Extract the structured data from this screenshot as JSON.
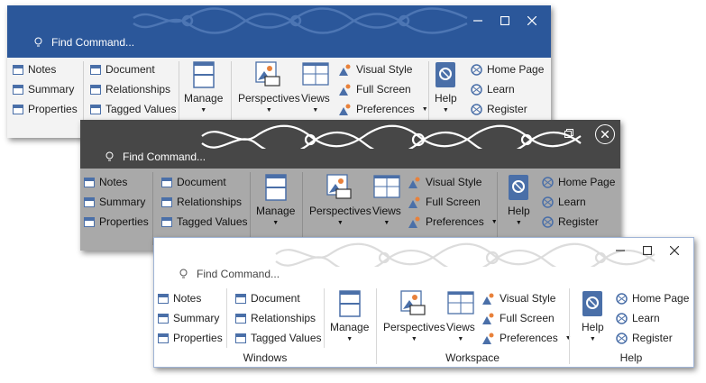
{
  "find": {
    "placeholder": "Find Command..."
  },
  "panels": [
    {
      "theme": "blue"
    },
    {
      "theme": "dark"
    },
    {
      "theme": "light"
    }
  ],
  "windows_group": {
    "label": "Windows",
    "notes": "Notes",
    "summary": "Summary",
    "properties": "Properties",
    "document": "Document",
    "relationships": "Relationships",
    "tagged_values": "Tagged Values",
    "manage": "Manage"
  },
  "workspace_group": {
    "label": "Workspace",
    "perspectives": "Perspectives",
    "views": "Views",
    "visual_style": "Visual Style",
    "full_screen": "Full Screen",
    "preferences": "Preferences"
  },
  "help_group": {
    "label": "Help",
    "help": "Help",
    "home_page": "Home Page",
    "learn": "Learn",
    "register": "Register"
  },
  "colors": {
    "blue_title": "#2b579a",
    "dark_title": "#474747",
    "dark_ribbon": "#a9a9a9",
    "light_ribbon": "#ffffff",
    "accent": "#4a6fa8"
  }
}
